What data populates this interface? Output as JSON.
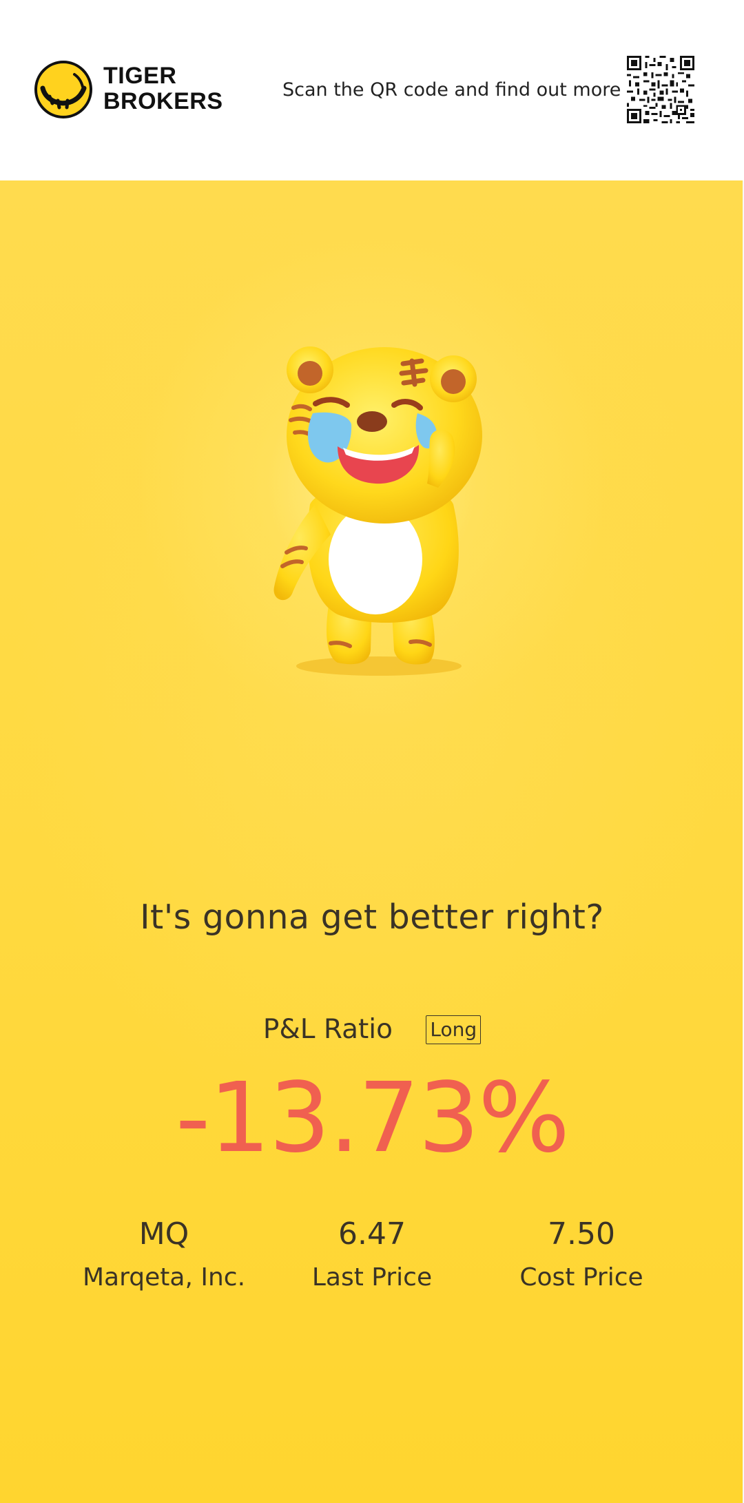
{
  "header": {
    "brand_line1": "TIGER",
    "brand_line2": "BROKERS",
    "scan_text": "Scan the QR code and find out more"
  },
  "poster": {
    "headline": "It's gonna get better right?",
    "pl_label": "P&L Ratio",
    "position_badge": "Long",
    "pl_value": "-13.73%",
    "stats": {
      "ticker": "MQ",
      "company": "Marqeta, Inc.",
      "last_price_value": "6.47",
      "last_price_label": "Last Price",
      "cost_price_value": "7.50",
      "cost_price_label": "Cost Price"
    }
  },
  "colors": {
    "accent_yellow": "#ffd93f",
    "loss_red": "#f06050",
    "text_dark": "#3a3326"
  },
  "icons": {
    "logo": "tiger-logo-icon",
    "qr": "qr-code-icon",
    "mascot": "crying-tiger-mascot"
  }
}
